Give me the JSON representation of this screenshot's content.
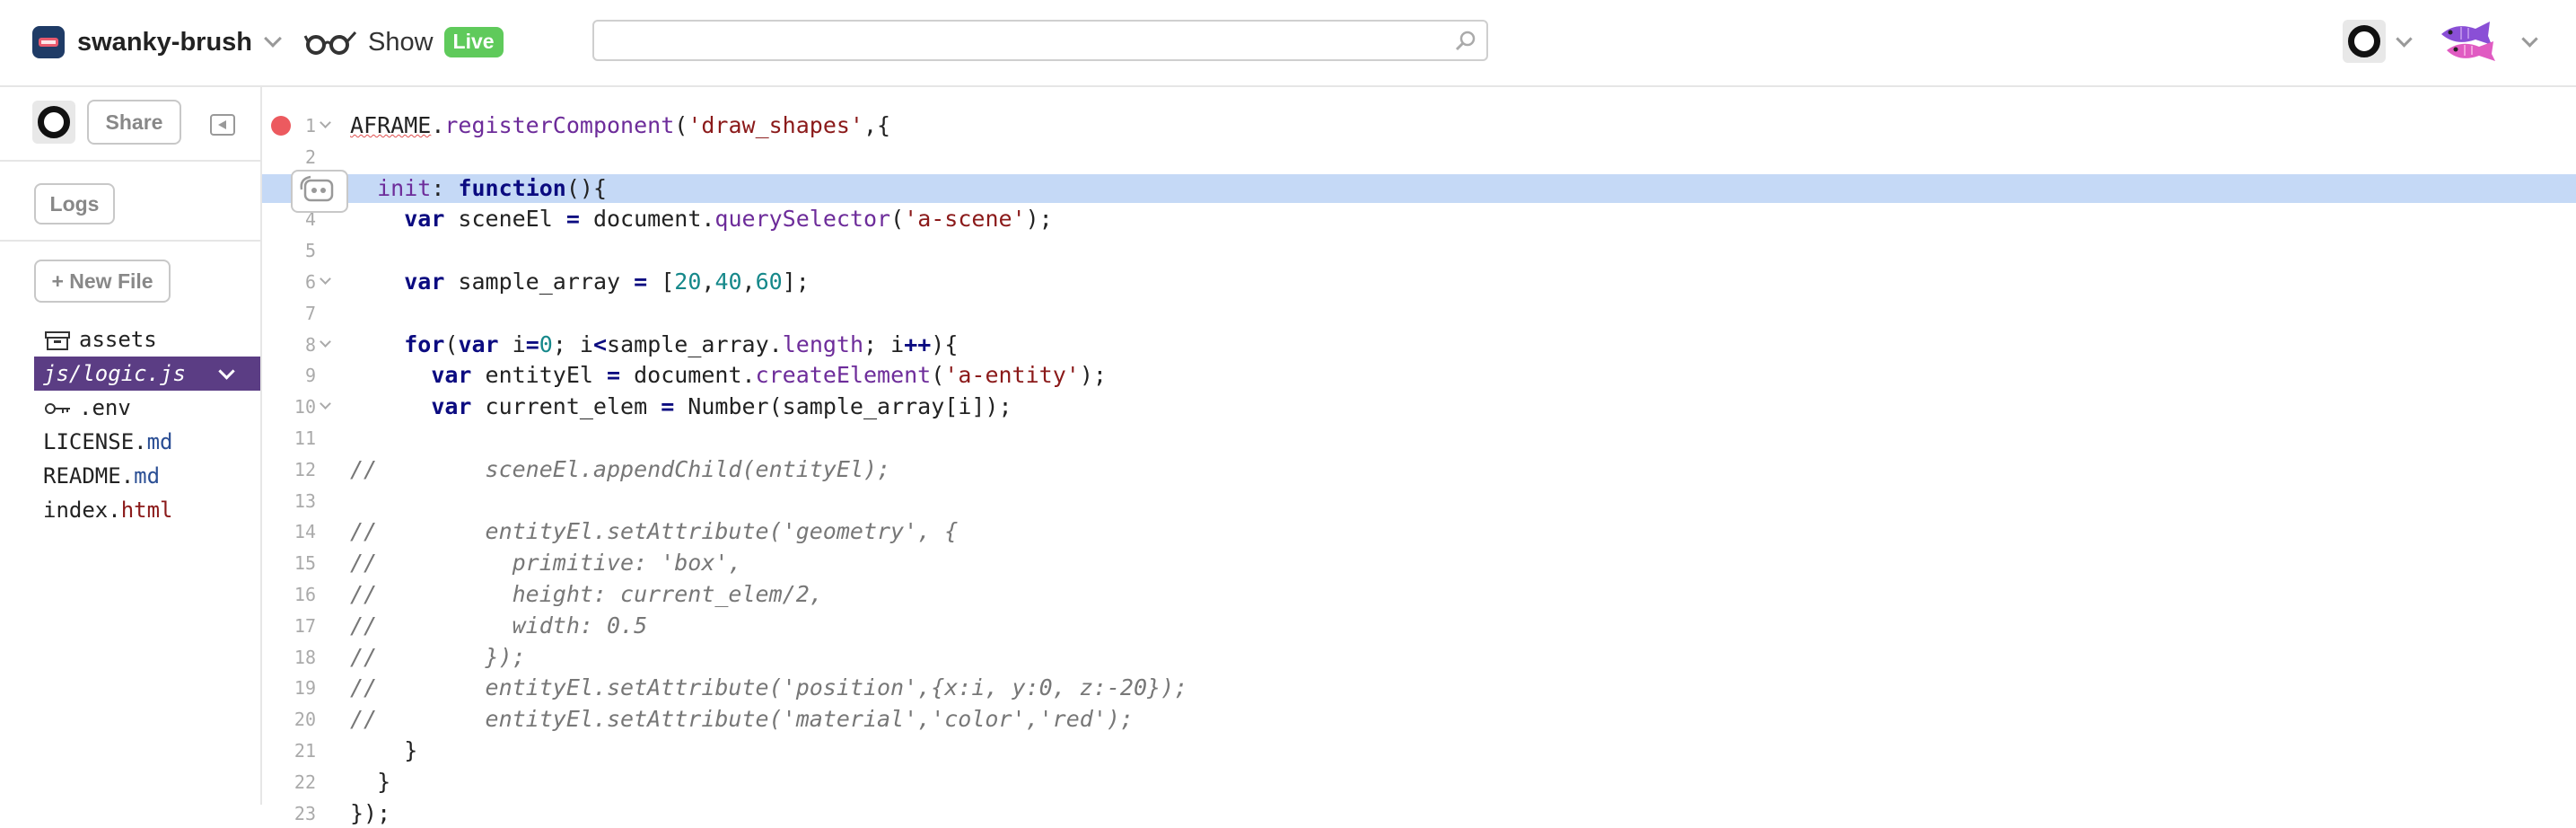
{
  "header": {
    "project_name": "swanky-brush",
    "show_label": "Show",
    "live_badge": "Live",
    "search": {
      "value": "",
      "placeholder": ""
    },
    "icons": [
      "project-logo",
      "glasses-icon",
      "search-icon",
      "user-avatar",
      "fish-icon"
    ]
  },
  "sidebar": {
    "share_label": "Share",
    "logs_label": "Logs",
    "new_file_label": "+ New File",
    "files": [
      {
        "name": "assets",
        "base": "assets",
        "ext": ""
      },
      {
        "name": "js/logic.js",
        "base": "js/logic.js",
        "ext": "",
        "active": true
      },
      {
        "name": ".env",
        "base": ".env",
        "ext": ""
      },
      {
        "name": "LICENSE.md",
        "base": "LICENSE.",
        "ext": "md"
      },
      {
        "name": "README.md",
        "base": "README.",
        "ext": "md"
      },
      {
        "name": "index.html",
        "base": "index.",
        "ext": "html"
      }
    ]
  },
  "editor": {
    "highlighted_line": 3,
    "lines": [
      {
        "n": "1",
        "fold": true,
        "tokens": [
          [
            "u",
            "AFRAME"
          ],
          [
            "",
            "."
          ],
          [
            "prop",
            "registerComponent"
          ],
          [
            "",
            "("
          ],
          [
            "str",
            "'draw_shapes'"
          ],
          [
            "",
            ",{"
          ]
        ]
      },
      {
        "n": "2",
        "tokens": []
      },
      {
        "n": "3",
        "tokens": [
          [
            "",
            "  "
          ],
          [
            "prop",
            "init"
          ],
          [
            "",
            ": "
          ],
          [
            "kw",
            "function"
          ],
          [
            "",
            "(){"
          ]
        ]
      },
      {
        "n": "4",
        "tokens": [
          [
            "",
            "    "
          ],
          [
            "kw",
            "var"
          ],
          [
            "",
            " sceneEl "
          ],
          [
            "kw",
            "="
          ],
          [
            "",
            " document."
          ],
          [
            "prop",
            "querySelector"
          ],
          [
            "",
            "("
          ],
          [
            "str",
            "'a-scene'"
          ],
          [
            "",
            ");"
          ]
        ]
      },
      {
        "n": "5",
        "tokens": []
      },
      {
        "n": "6",
        "fold": true,
        "tokens": [
          [
            "",
            "    "
          ],
          [
            "kw",
            "var"
          ],
          [
            "",
            " sample_array "
          ],
          [
            "kw",
            "="
          ],
          [
            "",
            " ["
          ],
          [
            "num",
            "20"
          ],
          [
            "",
            ","
          ],
          [
            "num",
            "40"
          ],
          [
            "",
            ","
          ],
          [
            "num",
            "60"
          ],
          [
            "",
            "];"
          ]
        ]
      },
      {
        "n": "7",
        "tokens": []
      },
      {
        "n": "8",
        "fold": true,
        "tokens": [
          [
            "",
            "    "
          ],
          [
            "kw",
            "for"
          ],
          [
            "",
            "("
          ],
          [
            "kw",
            "var"
          ],
          [
            "",
            " i"
          ],
          [
            "kw",
            "="
          ],
          [
            "num",
            "0"
          ],
          [
            "",
            "; i"
          ],
          [
            "kw",
            "<"
          ],
          [
            "",
            "sample_array."
          ],
          [
            "prop",
            "length"
          ],
          [
            "",
            "; i"
          ],
          [
            "kw",
            "++"
          ],
          [
            "",
            "){"
          ]
        ]
      },
      {
        "n": "9",
        "tokens": [
          [
            "",
            "      "
          ],
          [
            "kw",
            "var"
          ],
          [
            "",
            " entityEl "
          ],
          [
            "kw",
            "="
          ],
          [
            "",
            " document."
          ],
          [
            "prop",
            "createElement"
          ],
          [
            "",
            "("
          ],
          [
            "str",
            "'a-entity'"
          ],
          [
            "",
            ");"
          ]
        ]
      },
      {
        "n": "10",
        "fold": true,
        "tokens": [
          [
            "",
            "      "
          ],
          [
            "kw",
            "var"
          ],
          [
            "",
            " current_elem "
          ],
          [
            "kw",
            "="
          ],
          [
            "",
            " Number(sample_array[i]);"
          ]
        ]
      },
      {
        "n": "11",
        "tokens": []
      },
      {
        "n": "12",
        "tokens": [
          [
            "cmt",
            "//        sceneEl.appendChild(entityEl);"
          ]
        ]
      },
      {
        "n": "13",
        "tokens": []
      },
      {
        "n": "14",
        "tokens": [
          [
            "cmt",
            "//        entityEl.setAttribute('geometry', {"
          ]
        ]
      },
      {
        "n": "15",
        "tokens": [
          [
            "cmt",
            "//          primitive: 'box',"
          ]
        ]
      },
      {
        "n": "16",
        "tokens": [
          [
            "cmt",
            "//          height: current_elem/2,"
          ]
        ]
      },
      {
        "n": "17",
        "tokens": [
          [
            "cmt",
            "//          width: 0.5"
          ]
        ]
      },
      {
        "n": "18",
        "tokens": [
          [
            "cmt",
            "//        });"
          ]
        ]
      },
      {
        "n": "19",
        "tokens": [
          [
            "cmt",
            "//        entityEl.setAttribute('position',{x:i, y:0, z:-20});"
          ]
        ]
      },
      {
        "n": "20",
        "tokens": [
          [
            "cmt",
            "//        entityEl.setAttribute('material','color','red');"
          ]
        ]
      },
      {
        "n": "21",
        "tokens": [
          [
            "",
            "    }"
          ]
        ]
      },
      {
        "n": "22",
        "tokens": [
          [
            "",
            "  }"
          ]
        ]
      },
      {
        "n": "23",
        "tokens": [
          [
            "",
            "});"
          ]
        ]
      }
    ]
  },
  "colors": {
    "active_file_bg": "#5b3d84",
    "live_badge_bg": "#5fca5b",
    "line_highlight": "#c5d9f6",
    "breakpoint": "#ec5a5f",
    "keyword": "#0b0b80",
    "property": "#6d2c9a",
    "string": "#8b1a1a",
    "number": "#15888a",
    "comment": "#777777"
  }
}
